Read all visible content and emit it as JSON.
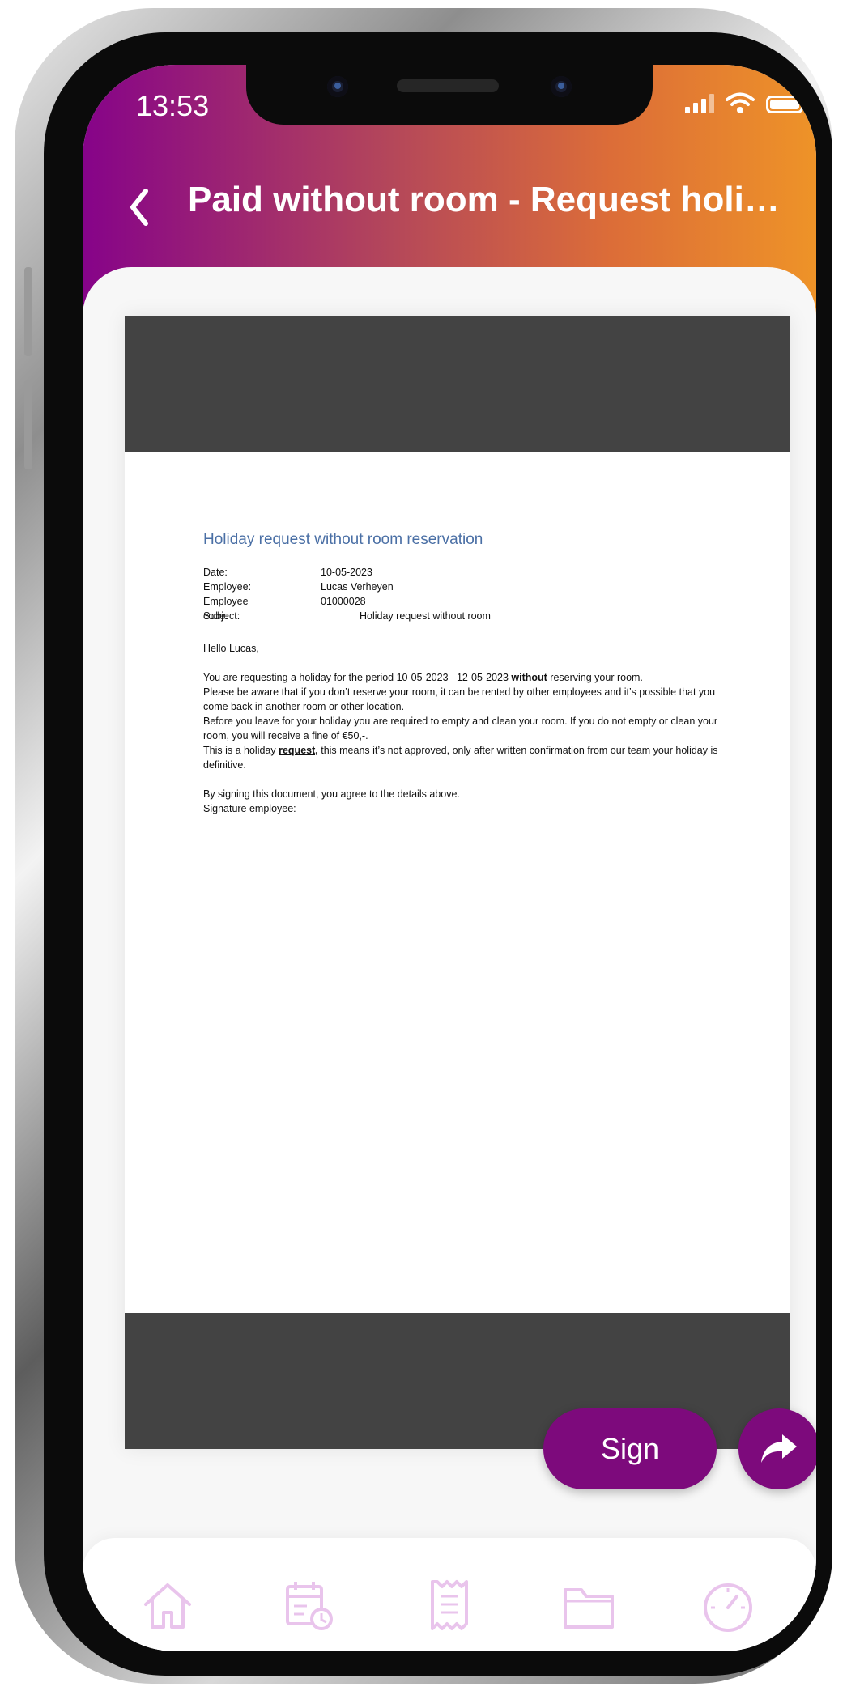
{
  "status_bar": {
    "time": "13:53"
  },
  "header": {
    "title": "Paid without room - Request holi…"
  },
  "document": {
    "heading": "Holiday request without room reservation",
    "fields": [
      {
        "label": "Date:",
        "value": "10-05-2023"
      },
      {
        "label": "Employee:",
        "value": "Lucas Verheyen"
      },
      {
        "label": "Employee code:",
        "value": "01000028"
      },
      {
        "label": "Subject:",
        "value": "Holiday request without room"
      }
    ],
    "greeting": "Hello Lucas,",
    "p1_pre": "You are requesting a holiday for the period 10-05-2023– 12-05-2023 ",
    "p1_bold": "without",
    "p1_post": " reserving your room.",
    "p2": "Please be aware that if you don’t reserve your room, it can be rented by other employees and it’s possible that you come back in another room or other location.",
    "p3": "Before you leave for your holiday you are required to empty and clean your room. If you do not empty or clean your room, you will receive a fine of €50,-.",
    "p4_pre": "This is a holiday ",
    "p4_bold": "request,",
    "p4_post": " this means it’s not approved, only after written confirmation from our team your holiday is definitive.",
    "p5": "By signing this document, you agree to the details above.",
    "p6": "Signature employee:"
  },
  "actions": {
    "sign_label": "Sign",
    "share_icon": "share-arrow-icon"
  },
  "tabbar": {
    "icons": [
      "home-icon",
      "calendar-clock-icon",
      "receipt-icon",
      "folder-icon",
      "speedometer-icon"
    ],
    "icon_color": "#e9c4ec"
  },
  "colors": {
    "header_gradient": [
      "#860389",
      "#b4475a",
      "#dc6d38",
      "#ee9328"
    ],
    "accent": "#7d0a7c",
    "doc_bar": "#434343",
    "doc_heading": "#4a6fa5"
  }
}
